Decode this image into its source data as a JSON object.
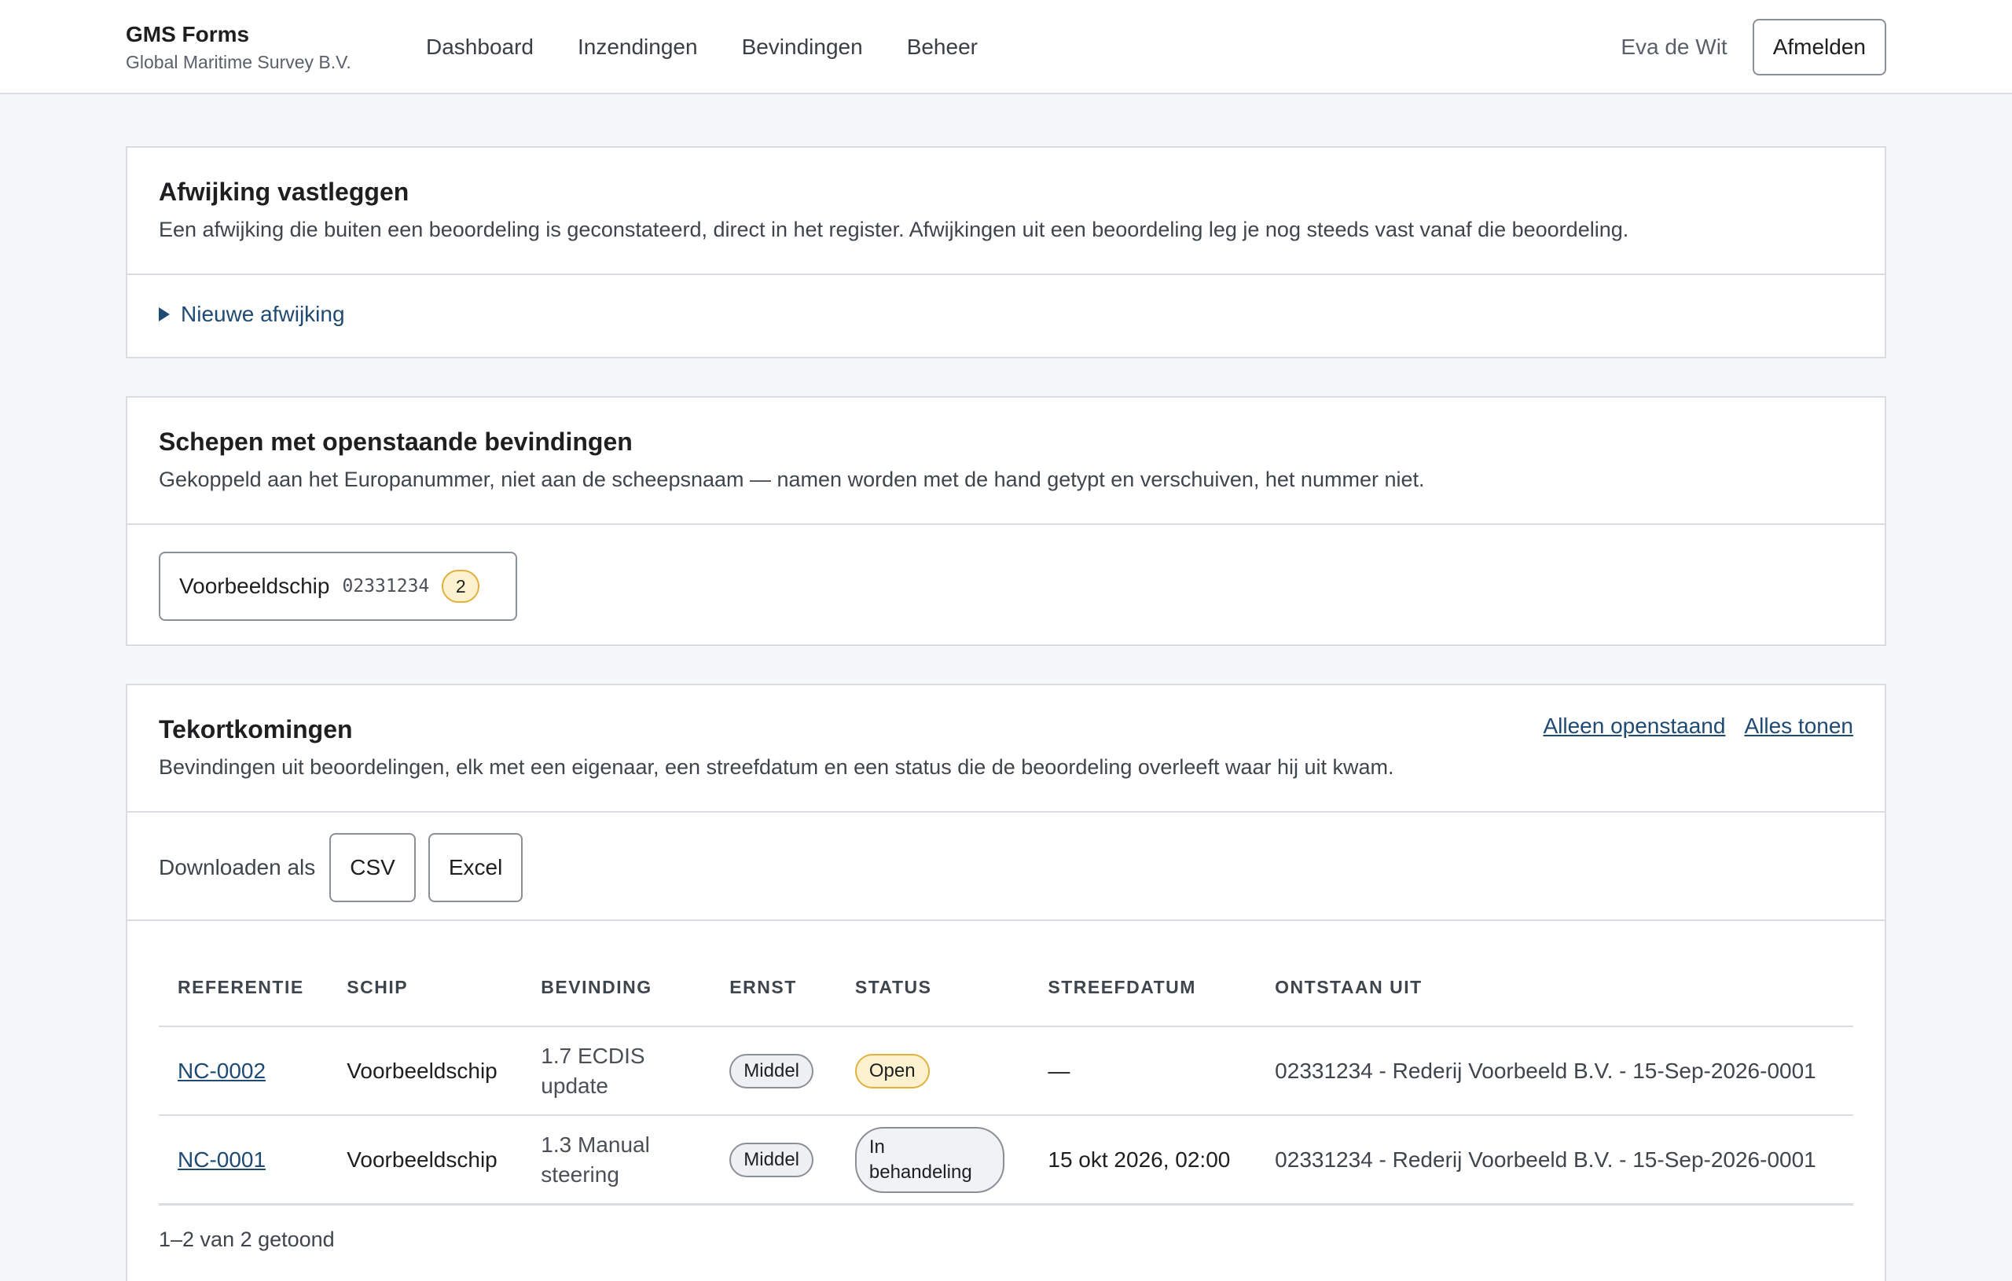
{
  "header": {
    "app_name": "GMS Forms",
    "org_name": "Global Maritime Survey B.V.",
    "nav": [
      "Dashboard",
      "Inzendingen",
      "Bevindingen",
      "Beheer"
    ],
    "user_name": "Eva de Wit",
    "logout_label": "Afmelden"
  },
  "record_deviation": {
    "title": "Afwijking vastleggen",
    "description": "Een afwijking die buiten een beoordeling is geconstateerd, direct in het register. Afwijkingen uit een beoordeling leg je nog steeds vast vanaf die beoordeling.",
    "new_deviation_label": "Nieuwe afwijking"
  },
  "open_ships": {
    "title": "Schepen met openstaande bevindingen",
    "description": "Gekoppeld aan het Europanummer, niet aan de scheepsnaam — namen worden met de hand getypt en verschuiven, het nummer niet.",
    "ships": [
      {
        "name": "Voorbeeldschip",
        "number": "02331234",
        "open_count": "2"
      }
    ]
  },
  "deficiencies": {
    "title": "Tekortkomingen",
    "description": "Bevindingen uit beoordelingen, elk met een eigenaar, een streefdatum en een status die de beoordeling overleeft waar hij uit kwam.",
    "filter_open_label": "Alleen openstaand",
    "filter_all_label": "Alles tonen",
    "download_label": "Downloaden als",
    "download_csv": "CSV",
    "download_excel": "Excel",
    "columns": [
      "REFERENTIE",
      "SCHIP",
      "BEVINDING",
      "ERNST",
      "STATUS",
      "STREEFDATUM",
      "ONTSTAAN UIT"
    ],
    "rows": [
      {
        "reference": "NC-0002",
        "ship": "Voorbeeldschip",
        "finding": "1.7 ECDIS update",
        "severity": "Middel",
        "status": "Open",
        "due_date": "—",
        "origin": "02331234 - Rederij Voorbeeld B.V. - 15-Sep-2026-0001"
      },
      {
        "reference": "NC-0001",
        "ship": "Voorbeeldschip",
        "finding": "1.3 Manual steering",
        "severity": "Middel",
        "status": "In behandeling",
        "due_date": "15 okt 2026, 02:00",
        "origin": "02331234 - Rederij Voorbeeld B.V. - 15-Sep-2026-0001"
      }
    ],
    "result_count": "1–2 van 2 getoond"
  },
  "colors": {
    "link": "#1e4a73",
    "badge_open_bg": "#fdf1cf",
    "badge_open_border": "#e0b13c",
    "border": "#d9dde2",
    "page_bg": "#f6f7f9"
  }
}
